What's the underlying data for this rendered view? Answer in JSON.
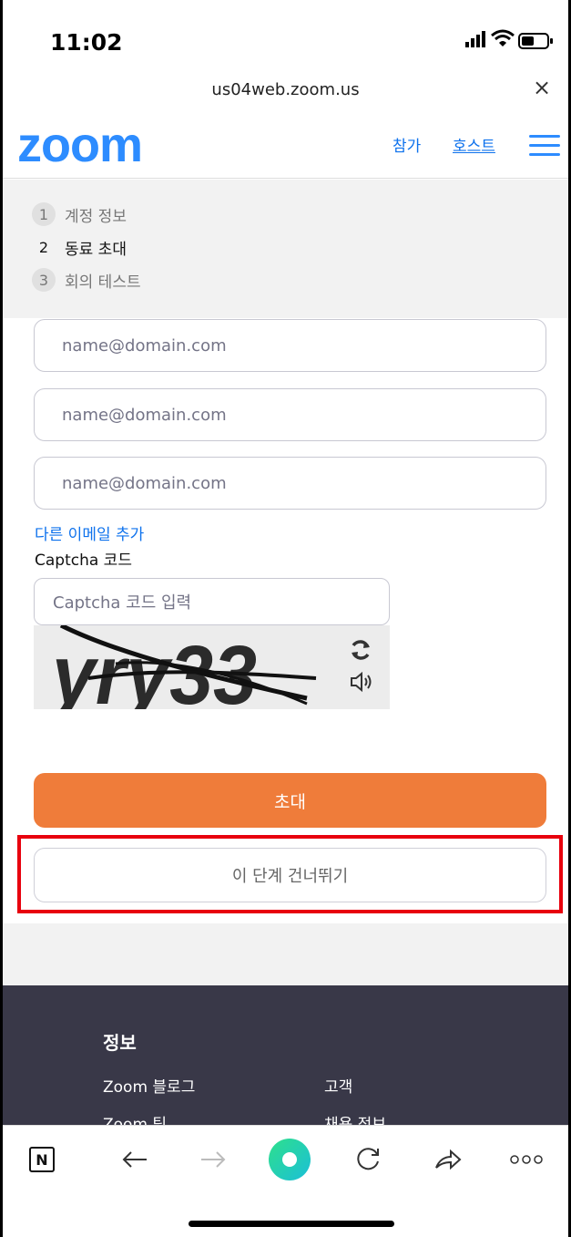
{
  "status_bar": {
    "time": "11:02"
  },
  "browser": {
    "url": "us04web.zoom.us",
    "close": "×"
  },
  "header": {
    "logo": "zoom",
    "join": "참가",
    "host": "호스트"
  },
  "steps": [
    {
      "num": "1",
      "label": "계정 정보",
      "active": false
    },
    {
      "num": "2",
      "label": "동료 초대",
      "active": true
    },
    {
      "num": "3",
      "label": "회의 테스트",
      "active": false
    }
  ],
  "form": {
    "email_placeholder_1": "name@domain.com",
    "email_placeholder_2": "name@domain.com",
    "email_placeholder_3": "name@domain.com",
    "add_email": "다른 이메일 추가",
    "captcha_label": "Captcha 코드",
    "captcha_placeholder": "Captcha 코드 입력",
    "captcha_text": "yry33",
    "invite": "초대",
    "skip": "이 단계 건너뛰기"
  },
  "footer": {
    "heading": "정보",
    "links_left": [
      "Zoom 블로그",
      "Zoom 팀"
    ],
    "links_right": [
      "고객",
      "채용 정보"
    ]
  },
  "toolbar": {
    "n_label": "N"
  },
  "colors": {
    "zoom_blue": "#2d8cff",
    "link_blue": "#0e72ed",
    "invite_orange": "#ef7c3a",
    "highlight_red": "#e8000d",
    "footer_bg": "#393848"
  },
  "icons": [
    "signal-icon",
    "wifi-icon",
    "battery-icon",
    "close-icon",
    "hamburger-menu-icon",
    "refresh-icon",
    "speaker-icon",
    "back-arrow-icon",
    "forward-arrow-icon",
    "reload-icon",
    "share-icon",
    "more-icon"
  ]
}
